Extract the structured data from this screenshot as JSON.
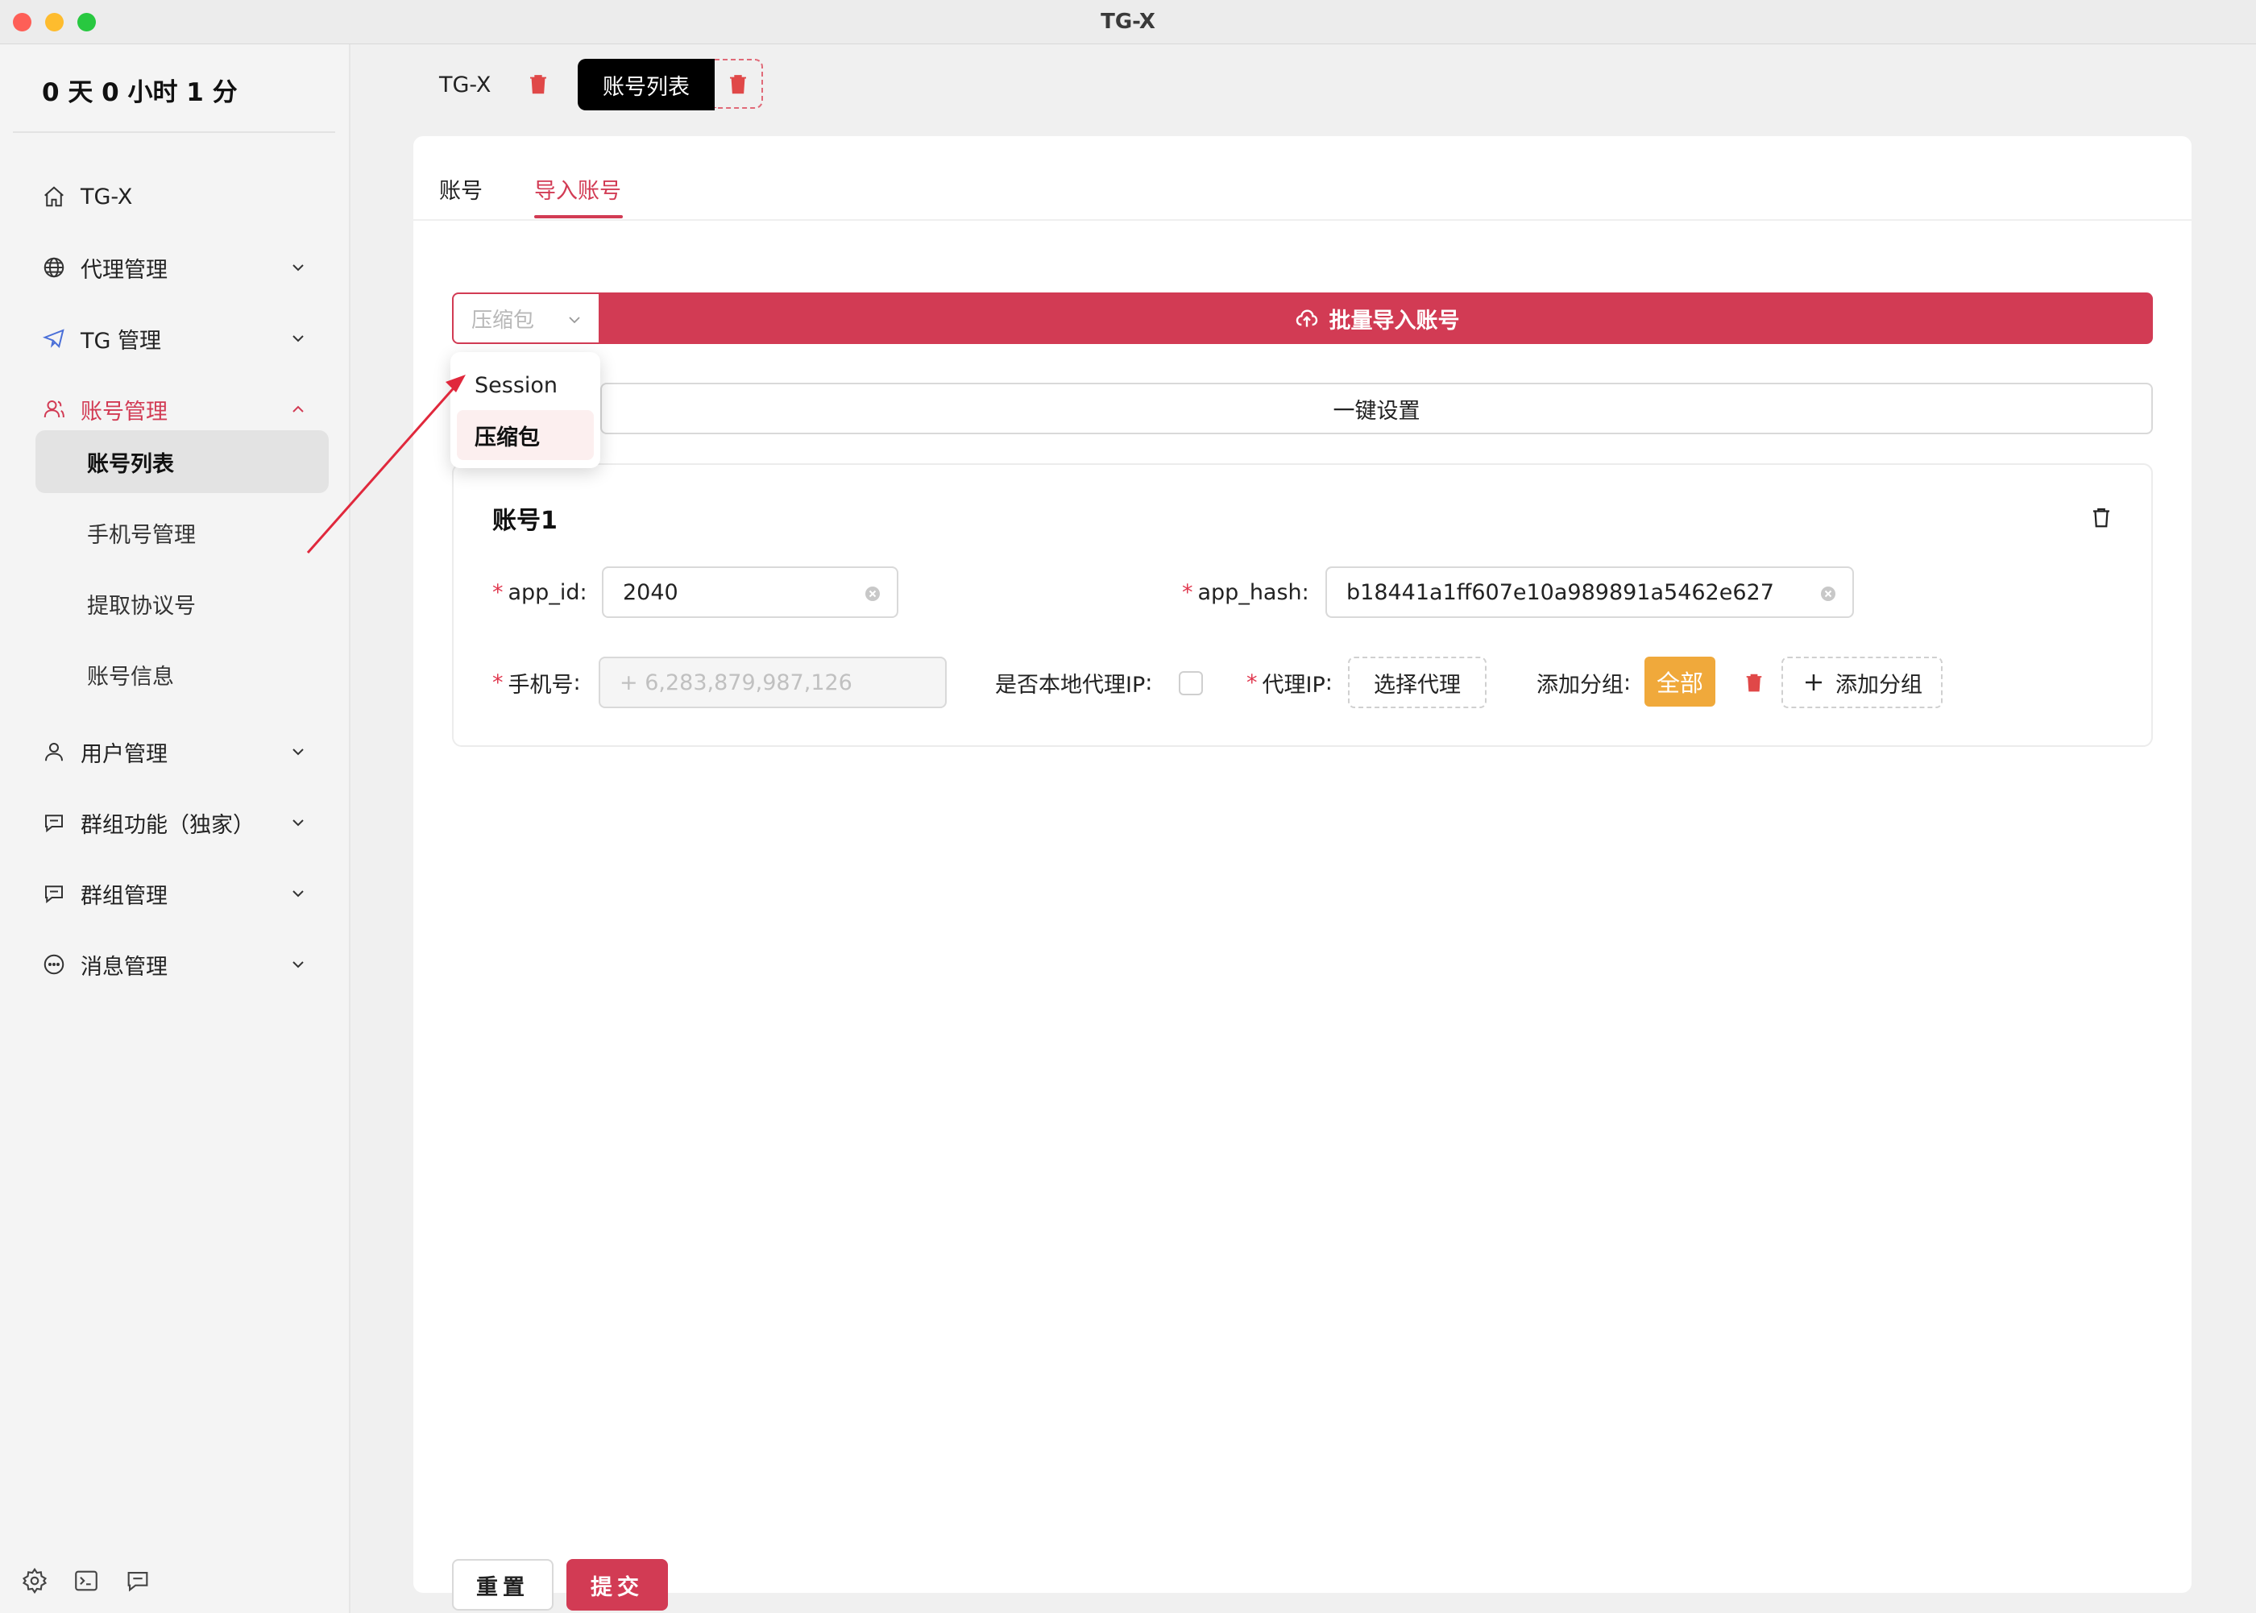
{
  "window": {
    "title": "TG-X"
  },
  "sidebar": {
    "uptime": "0 天 0 小时 1 分",
    "items": [
      {
        "label": "TG-X",
        "icon": "home-icon"
      },
      {
        "label": "代理管理",
        "icon": "globe-icon"
      },
      {
        "label": "TG 管理",
        "icon": "telegram-icon"
      },
      {
        "label": "账号管理",
        "icon": "users-icon"
      },
      {
        "label": "用户管理",
        "icon": "user-icon"
      },
      {
        "label": "群组功能（独家）",
        "icon": "chat-icon"
      },
      {
        "label": "群组管理",
        "icon": "chat-icon"
      },
      {
        "label": "消息管理",
        "icon": "message-icon"
      }
    ],
    "sub_items": [
      "账号列表",
      "手机号管理",
      "提取协议号",
      "账号信息"
    ],
    "bottom_icons": [
      "settings-icon",
      "terminal-icon",
      "chat-icon"
    ]
  },
  "tabs": {
    "first": "TG-X",
    "active": "账号列表"
  },
  "panel": {
    "tabs": [
      "账号",
      "导入账号"
    ],
    "select_value": "压缩包",
    "import_button": "批量导入账号",
    "dropdown_options": [
      "Session",
      "压缩包"
    ],
    "onekey_button": "一键设置",
    "card": {
      "title": "账号1",
      "app_id_label": "app_id",
      "app_id_value": "2040",
      "app_hash_label": "app_hash",
      "app_hash_value": "b18441a1ff607e10a989891a5462e627",
      "phone_label": "手机号",
      "phone_placeholder": "+ 6,283,879,987,126",
      "local_proxy_label": "是否本地代理IP",
      "proxy_label": "代理IP",
      "proxy_button": "选择代理",
      "group_label": "添加分组",
      "group_tag": "全部",
      "add_group_button": "添加分组"
    },
    "reset_button": "重置",
    "submit_button": "提交"
  },
  "colors": {
    "accent": "#d23b54",
    "tag": "#f0a93b"
  }
}
